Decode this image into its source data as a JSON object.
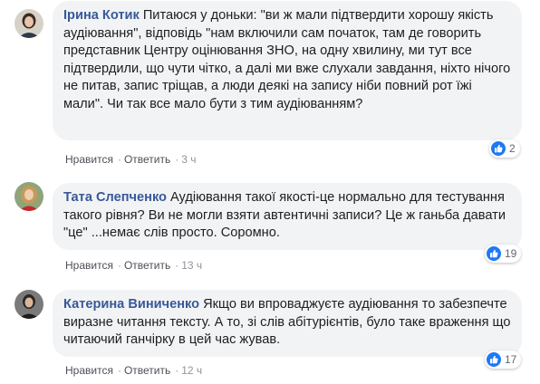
{
  "comments": [
    {
      "author": "Ірина Котик",
      "text": "Питаюся у доньки: \"ви ж мали підтвердити хорошу якість аудіювання\", відповідь \"нам включили сам початок, там де говорить представник Центру оцінювання ЗНО, на одну хвилину, ми тут все підтвердили, що чути чітко, а далі ми вже слухали завдання, ніхто нічого не питав, запис тріщав, а люди деякі на запису ніби повний рот їжі мали\". Чи так все мало бути з тим аудіюванням?",
      "like_label": "Нравится",
      "reply_label": "Ответить",
      "time": "3 ч",
      "reaction_count": "2"
    },
    {
      "author": "Тата Слепченко",
      "text": "Аудіювання такої якості-це нормально для тестування такого рівня? Ви не могли взяти автентичні записи? Це ж ганьба давати \"це\" ...немає слів просто. Соромно.",
      "like_label": "Нравится",
      "reply_label": "Ответить",
      "time": "13 ч",
      "reaction_count": "19"
    },
    {
      "author": "Катерина Виниченко",
      "text": "Якщо ви впроваджуєте аудіювання то забезпечте виразне читання тексту. А то, зі слів абітурієнтів, було таке враження що читаючий ганчірку в цей час жував.",
      "like_label": "Нравится",
      "reply_label": "Ответить",
      "time": "12 ч",
      "reaction_count": "17"
    }
  ],
  "colors": {
    "author": "#385898",
    "bubble": "#f2f3f5",
    "like_blue": "#2078f4",
    "meta": "#90949c"
  },
  "icons": [
    "avatar",
    "like-icon"
  ]
}
